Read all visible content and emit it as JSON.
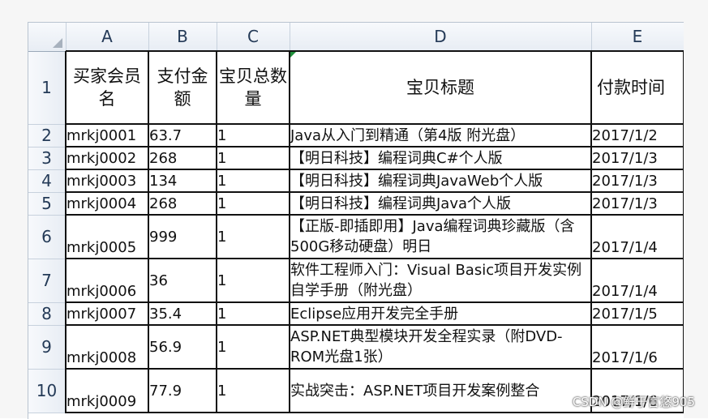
{
  "columns": [
    "A",
    "B",
    "C",
    "D",
    "E"
  ],
  "headers": {
    "row_number": "1",
    "buyer": "买家会员名",
    "amount": "支付金额",
    "quantity": "宝贝总数量",
    "title": "宝贝标题",
    "pay_time": "付款时间"
  },
  "rows": [
    {
      "n": "2",
      "buyer": "mrkj0001",
      "amount": "63.7",
      "qty": "1",
      "title": "Java从入门到精通（第4版 附光盘）",
      "date": "2017/1/2"
    },
    {
      "n": "3",
      "buyer": "mrkj0002",
      "amount": "268",
      "qty": "1",
      "title": "【明日科技】编程词典C#个人版",
      "date": "2017/1/3"
    },
    {
      "n": "4",
      "buyer": "mrkj0003",
      "amount": "134",
      "qty": "1",
      "title": "【明日科技】编程词典JavaWeb个人版",
      "date": "2017/1/3"
    },
    {
      "n": "5",
      "buyer": "mrkj0004",
      "amount": "268",
      "qty": "1",
      "title": "【明日科技】编程词典Java个人版",
      "date": "2017/1/3"
    },
    {
      "n": "6",
      "buyer": "mrkj0005",
      "amount": "999",
      "qty": "1",
      "title": "【正版-即插即用】Java编程词典珍藏版（含500G移动硬盘）明日",
      "date": "2017/1/4"
    },
    {
      "n": "7",
      "buyer": "mrkj0006",
      "amount": "36",
      "qty": "1",
      "title": "软件工程师入门：Visual Basic项目开发实例自学手册（附光盘）",
      "date": "2017/1/4"
    },
    {
      "n": "8",
      "buyer": "mrkj0007",
      "amount": "35.4",
      "qty": "1",
      "title": "Eclipse应用开发完全手册",
      "date": "2017/1/5"
    },
    {
      "n": "9",
      "buyer": "mrkj0008",
      "amount": "56.9",
      "qty": "1",
      "title": "ASP.NET典型模块开发全程实录（附DVD-ROM光盘1张）",
      "date": "2017/1/6"
    },
    {
      "n": "10",
      "buyer": "mrkj0009",
      "amount": "77.9",
      "qty": "1",
      "title": "实战突击：ASP.NET项目开发案例整合",
      "date": "2017/1/6"
    }
  ],
  "watermark": "CSDN @鲜于言悠905"
}
